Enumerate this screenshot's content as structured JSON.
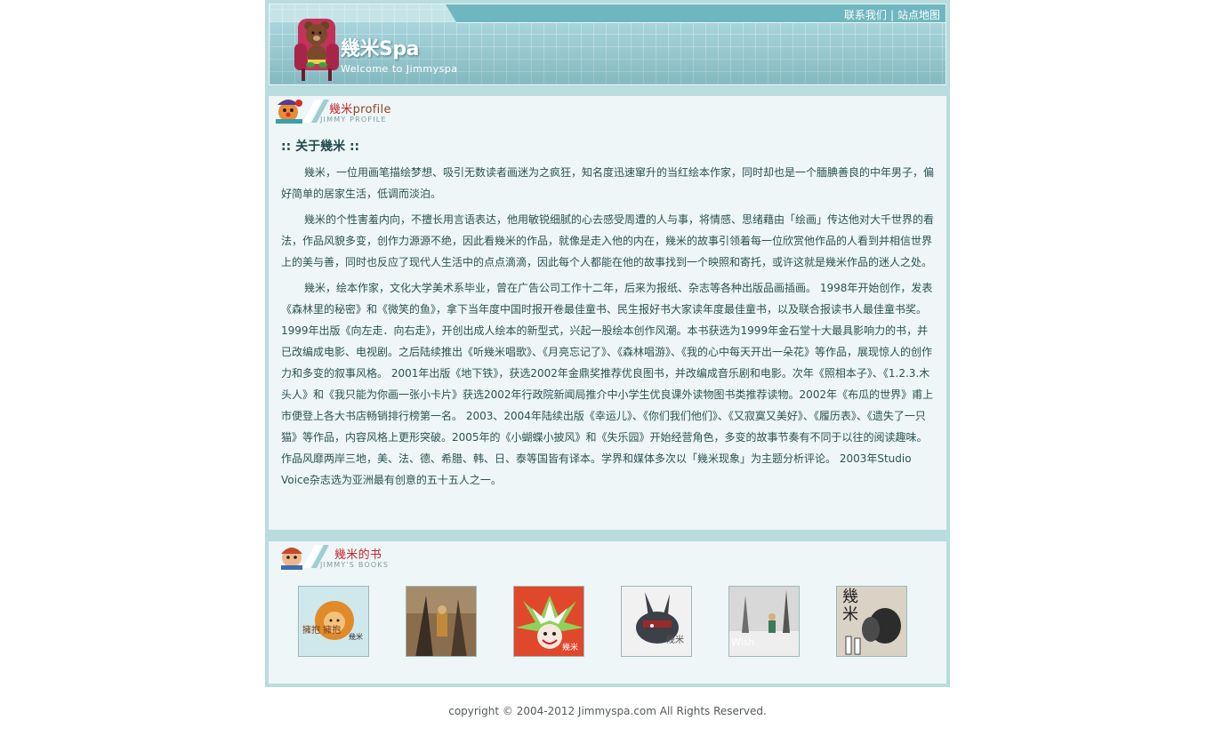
{
  "header": {
    "links": [
      "联系我们",
      "站点地图"
    ],
    "separator": "|",
    "logo_title": "幾米Spa",
    "logo_subtitle": "Welcome to Jimmyspa"
  },
  "profile_section": {
    "title_cn": "幾米",
    "title_en": "profile",
    "subtitle": "JIMMY PROFILE",
    "heading": ":: 关于幾米 ::",
    "paragraphs": [
      "幾米，一位用画笔描绘梦想、吸引无数读者画迷为之疯狂，知名度迅速窜升的当红绘本作家，同时却也是一个腼腆善良的中年男子，偏好简单的居家生活，低调而淡泊。",
      "幾米的个性害羞内向，不擅长用言语表达，他用敏锐细腻的心去感受周遭的人与事，将情感、思绪藉由「绘画」传达他对大千世界的看法，作品风貌多变，创作力源源不绝，因此看幾米的作品，就像是走入他的内在，幾米的故事引领着每一位欣赏他作品的人看到并相信世界上的美与善，同时也反应了现代人生活中的点点滴滴，因此每个人都能在他的故事找到一个映照和寄托，或许这就是幾米作品的迷人之处。",
      "幾米，绘本作家，文化大学美术系毕业，曾在广告公司工作十二年，后来为报纸、杂志等各种出版品画插画。 1998年开始创作，发表《森林里的秘密》和《微笑的鱼》，拿下当年度中国时报开卷最佳童书、民生报好书大家读年度最佳童书，以及联合报读书人最佳童书奖。 1999年出版《向左走．向右走》，开创出成人绘本的新型式，兴起一股绘本创作风潮。本书获选为1999年金石堂十大最具影响力的书，并已改编成电影、电视剧。之后陆续推出《听幾米唱歌》、《月亮忘记了》、《森林唱游》、《我的心中每天开出一朵花》等作品，展现惊人的创作力和多变的叙事风格。 2001年出版《地下铁》，获选2002年金鼎奖推荐优良图书，并改编成音乐剧和电影。次年《照相本子》、《1.2.3.木头人》和《我只能为你画一张小卡片》获选2002年行政院新闻局推介中小学生优良课外读物图书类推荐读物。2002年《布瓜的世界》甫上市便登上各大书店畅销排行榜第一名。 2003、2004年陆续出版《幸运儿》、《你们我们他们》、《又寂寞又美好》、《履历表》、《遗失了一只猫》等作品，内容风格上更形突破。2005年的《小蝴蝶小披风》和《失乐园》开始经营角色，多变的故事节奏有不同于以往的阅读趣味。 作品风靡两岸三地，美、法、德、希腊、韩、日、泰等国皆有译本。学界和媒体多次以「幾米现象」为主题分析评论。 2003年Studio Voice杂志选为亚洲最有创意的五十五人之一。"
    ]
  },
  "books_section": {
    "title_cn": "幾米的书",
    "subtitle": "JIMMY'S  BOOKS",
    "books": [
      {
        "cover_text": "擁抱 擁抱",
        "author": "幾米",
        "bg": "#cfe8ec",
        "accent": "#e08a2a"
      },
      {
        "cover_text": "",
        "author": "",
        "bg": "#8a6d4c",
        "accent": "#3a2e24"
      },
      {
        "cover_text": "",
        "author": "幾米",
        "bg": "#e0482b",
        "accent": "#8fd15a"
      },
      {
        "cover_text": "",
        "author": "幾米",
        "bg": "#f1f1f1",
        "accent": "#3c4048"
      },
      {
        "cover_text": "Wish",
        "author": "",
        "bg": "#d8d8d8",
        "accent": "#6d6d6d"
      },
      {
        "cover_text": "幾 米",
        "author": "",
        "bg": "#d9d2c5",
        "accent": "#2c2c2c"
      }
    ]
  },
  "footer": {
    "copyright": "copyright © 2004-2012 Jimmyspa.com All Rights Reserved."
  }
}
